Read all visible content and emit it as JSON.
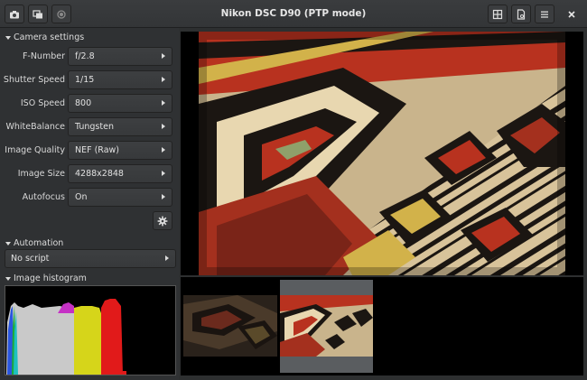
{
  "window": {
    "title": "Nikon DSC D90 (PTP mode)"
  },
  "header_left_buttons": [
    {
      "name": "camera-capture-icon"
    },
    {
      "name": "burst-capture-icon"
    },
    {
      "name": "record-icon"
    }
  ],
  "header_right_buttons": [
    {
      "name": "grid-view-icon"
    },
    {
      "name": "document-icon"
    },
    {
      "name": "hamburger-menu-icon"
    },
    {
      "name": "close-icon"
    }
  ],
  "sections": {
    "camera_settings": "Camera settings",
    "automation": "Automation",
    "histogram": "Image histogram"
  },
  "settings": [
    {
      "label": "F-Number",
      "value": "f/2.8"
    },
    {
      "label": "Shutter Speed",
      "value": "1/15"
    },
    {
      "label": "ISO Speed",
      "value": "800"
    },
    {
      "label": "WhiteBalance",
      "value": "Tungsten"
    },
    {
      "label": "Image Quality",
      "value": "NEF (Raw)"
    },
    {
      "label": "Image Size",
      "value": "4288x2848"
    },
    {
      "label": "Autofocus",
      "value": "On"
    }
  ],
  "automation": {
    "script": "No script"
  },
  "colors": {
    "rug_red": "#b8321f",
    "rug_cream": "#e8d7b0",
    "rug_black": "#1b1612",
    "rug_green": "#8fa06a",
    "rug_yellow": "#d2b24a"
  }
}
